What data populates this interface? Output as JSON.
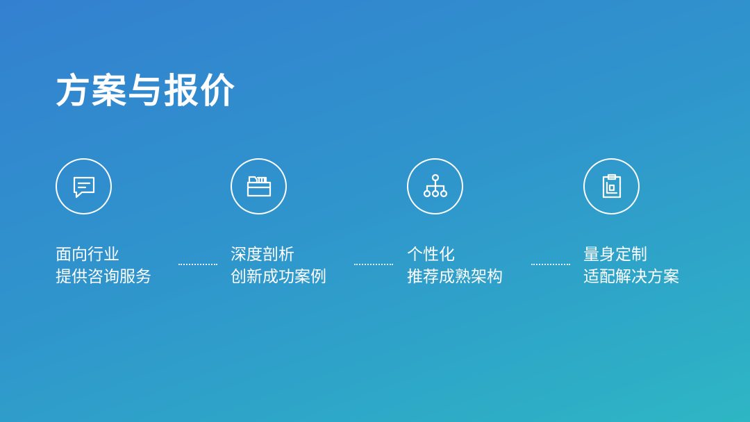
{
  "title": "方案与报价",
  "features": [
    {
      "icon": "chat-icon",
      "line1": "面向行业",
      "line2": "提供咨询服务"
    },
    {
      "icon": "folder-icon",
      "line1": "深度剖析",
      "line2": "创新成功案例"
    },
    {
      "icon": "hierarchy-icon",
      "line1": "个性化",
      "line2": "推荐成熟架构"
    },
    {
      "icon": "clipboard-icon",
      "line1": "量身定制",
      "line2": "适配解决方案"
    }
  ],
  "colors": {
    "gradient_start": "#3380d0",
    "gradient_end": "#2eb6c4",
    "foreground": "#ffffff"
  }
}
